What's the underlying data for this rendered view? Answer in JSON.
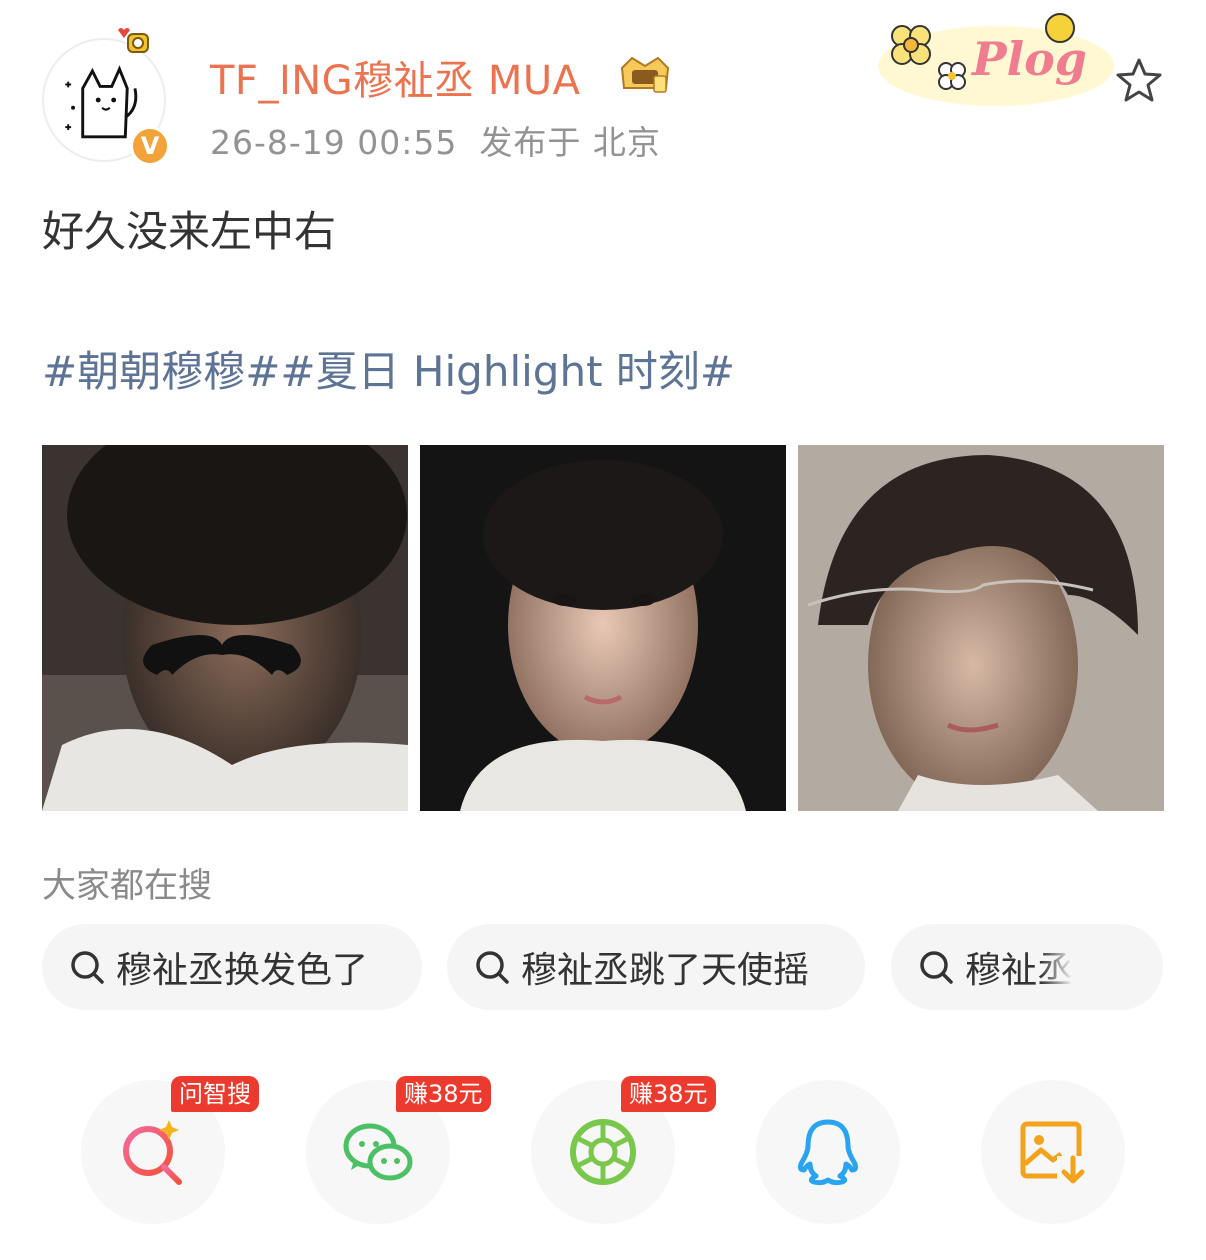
{
  "post": {
    "username": "TF_ING穆祉丞 MUA",
    "time": "26-8-19 00:55",
    "location": "发布于 北京",
    "verified_badge": "V",
    "text": "好久没来左中右",
    "tags": [
      "#朝朝穆穆#",
      "#夏日 Highlight 时刻#"
    ],
    "sticker_text": "Plog"
  },
  "search": {
    "title": "大家都在搜",
    "chips": [
      "穆祉丞换发色了",
      "穆祉丞跳了天使摇",
      "穆祉丞"
    ]
  },
  "share": {
    "badges": [
      "问智搜",
      "赚38元",
      "赚38元"
    ],
    "icons": [
      "ai-search-icon",
      "wechat-icon",
      "moments-icon",
      "qq-icon",
      "save-image-icon"
    ]
  },
  "colors": {
    "username": "#eb7350",
    "tag": "#5d7496",
    "badge": "#ec3b2e",
    "wechat": "#4cc065",
    "qq": "#2aa3f0",
    "save": "#f3a21c"
  }
}
